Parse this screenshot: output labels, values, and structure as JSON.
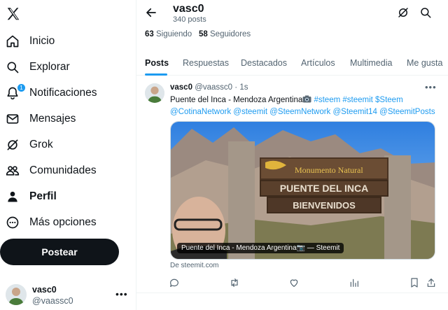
{
  "nav": {
    "items": [
      {
        "label": "Inicio",
        "icon": "home-icon"
      },
      {
        "label": "Explorar",
        "icon": "search-icon"
      },
      {
        "label": "Notificaciones",
        "icon": "bell-icon",
        "badge": "1"
      },
      {
        "label": "Mensajes",
        "icon": "envelope-icon"
      },
      {
        "label": "Grok",
        "icon": "grok-icon"
      },
      {
        "label": "Comunidades",
        "icon": "people-icon"
      },
      {
        "label": "Perfil",
        "icon": "person-icon"
      },
      {
        "label": "Más opciones",
        "icon": "more-circle-icon"
      }
    ],
    "post_button": "Postear"
  },
  "account": {
    "name": "vasc0",
    "handle": "@vaassc0"
  },
  "profile": {
    "name": "vasc0",
    "posts_count": "340 posts",
    "following_count": "63",
    "following_label": "Siguiendo",
    "followers_count": "58",
    "followers_label": "Seguidores"
  },
  "tabs": [
    "Posts",
    "Respuestas",
    "Destacados",
    "Artículos",
    "Multimedia",
    "Me gusta"
  ],
  "active_tab": "Posts",
  "tweet": {
    "author": "vasc0",
    "handle": "@vaassc0",
    "separator": "·",
    "time": "1s",
    "text_plain": "Puente del Inca - Mendoza Argentina",
    "tags_line1": "#steem #steemit $Steem",
    "tags_line2": "@CotinaNetwork @steemit @SteemNetwork @Steemit14 @SteemitPosts",
    "card_caption": "Puente del Inca - Mendoza Argentina📷 — Steemit",
    "card_source": "De steemit.com",
    "sign_line1": "Monumento Natural",
    "sign_line2": "PUENTE DEL INCA",
    "sign_line3": "BIENVENIDOS"
  },
  "colors": {
    "accent": "#1d9bf0",
    "text": "#0f1419",
    "muted": "#536471",
    "border": "#eff3f4"
  }
}
